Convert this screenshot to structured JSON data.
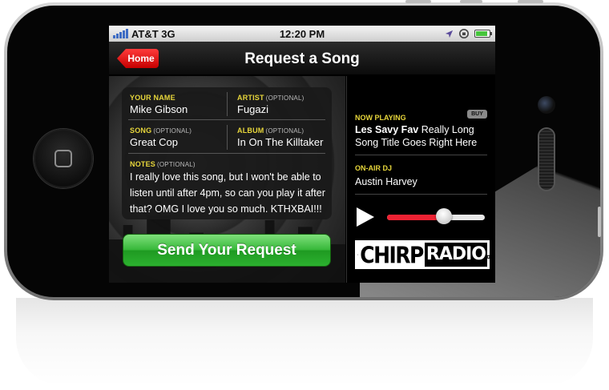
{
  "status_bar": {
    "carrier": "AT&T 3G",
    "time": "12:20 PM"
  },
  "nav": {
    "back_label": "Home",
    "title": "Request a Song"
  },
  "form": {
    "your_name": {
      "label": "YOUR NAME",
      "value": "Mike Gibson"
    },
    "artist": {
      "label": "ARTIST",
      "optional": "(OPTIONAL)",
      "value": "Fugazi"
    },
    "song": {
      "label": "SONG",
      "optional": "(OPTIONAL)",
      "value": "Great Cop"
    },
    "album": {
      "label": "ALBUM",
      "optional": "(OPTIONAL)",
      "value": "In On The Killtaker"
    },
    "notes": {
      "label": "NOTES",
      "optional": "(OPTIONAL)",
      "value": "I really love this song, but I won't be able to listen until after 4pm, so can you play it after that? OMG I love you so much. KTHXBAI!!!"
    },
    "submit_label": "Send Your Request"
  },
  "now_playing": {
    "label": "NOW PLAYING",
    "buy_label": "BUY",
    "artist": "Les Savy Fav",
    "title": "Really Long Song Title Goes Right Here"
  },
  "dj": {
    "label": "ON-AIR DJ",
    "name": "Austin Harvey"
  },
  "player": {
    "volume": 0.58
  },
  "logo": {
    "chirp": "CHIRP",
    "radio": "RADIO",
    "tld": ".org"
  },
  "colors": {
    "accent_yellow": "#e7d63b",
    "back_button_red": "#d40000",
    "send_button_green": "#2cb12f",
    "volume_fill_red": "#ee2233"
  }
}
